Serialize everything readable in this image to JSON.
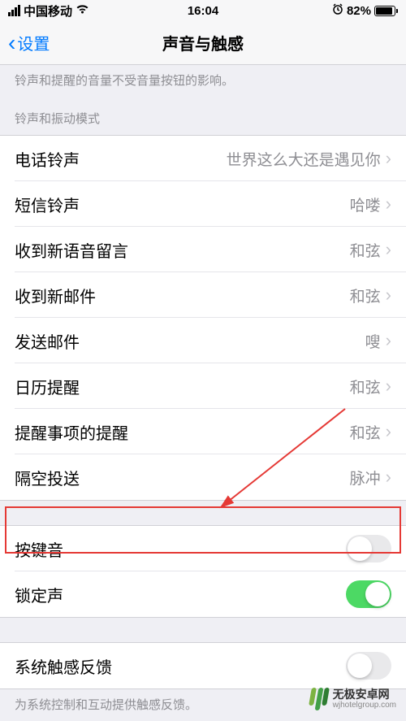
{
  "status": {
    "carrier": "中国移动",
    "time": "16:04",
    "battery_pct": "82%"
  },
  "nav": {
    "back": "设置",
    "title": "声音与触感"
  },
  "footer1": "铃声和提醒的音量不受音量按钮的影响。",
  "section_header": "铃声和振动模式",
  "sounds": [
    {
      "label": "电话铃声",
      "value": "世界这么大还是遇见你"
    },
    {
      "label": "短信铃声",
      "value": "哈喽"
    },
    {
      "label": "收到新语音留言",
      "value": "和弦"
    },
    {
      "label": "收到新邮件",
      "value": "和弦"
    },
    {
      "label": "发送邮件",
      "value": "嗖"
    },
    {
      "label": "日历提醒",
      "value": "和弦"
    },
    {
      "label": "提醒事项的提醒",
      "value": "和弦"
    },
    {
      "label": "隔空投送",
      "value": "脉冲"
    }
  ],
  "toggles": {
    "keyboard_clicks": {
      "label": "按键音",
      "on": false
    },
    "lock_sound": {
      "label": "锁定声",
      "on": true
    }
  },
  "haptics": {
    "label": "系统触感反馈",
    "on": false
  },
  "footer2": "为系统控制和互动提供触感反馈。",
  "watermark": {
    "title": "无极安卓网",
    "url": "wjhotelgroup.com"
  }
}
